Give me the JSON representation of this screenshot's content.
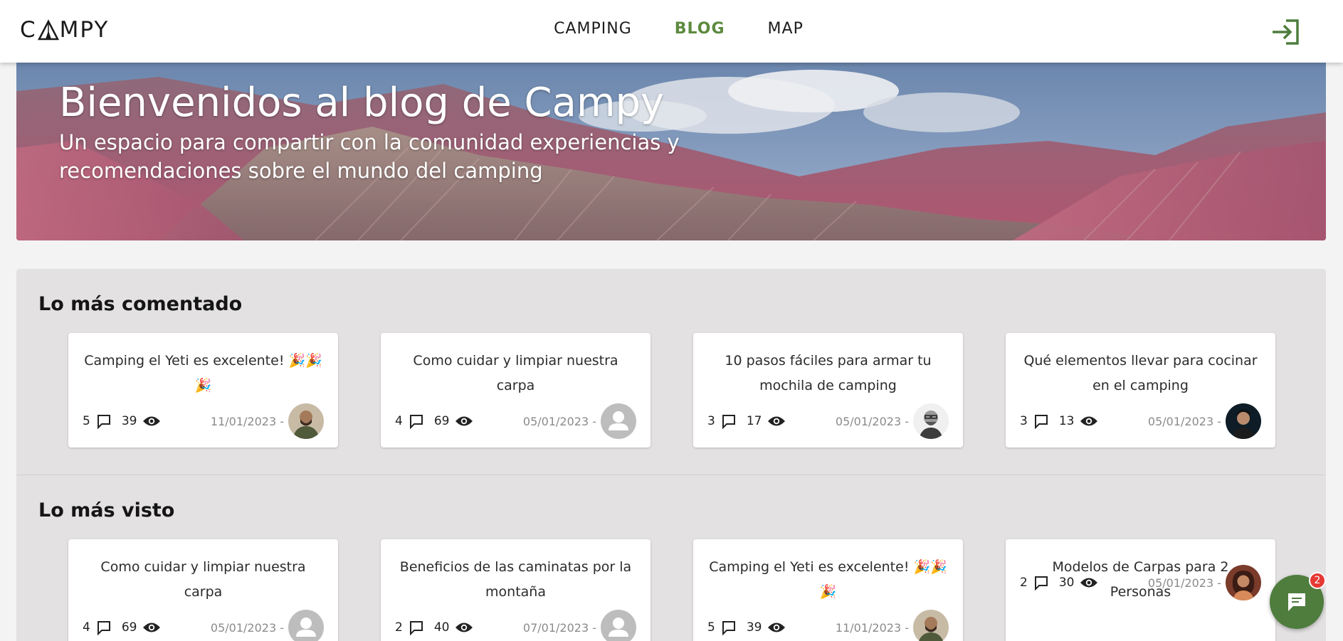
{
  "header": {
    "logo_text_left": "C",
    "logo_text_right": "MPY",
    "nav": [
      {
        "label": "CAMPING",
        "active": false
      },
      {
        "label": "BLOG",
        "active": true
      },
      {
        "label": "MAP",
        "active": false
      }
    ],
    "login_icon": "login-icon"
  },
  "hero": {
    "title": "Bienvenidos al blog de Campy",
    "subtitle": "Un espacio para compartir con la comunidad experiencias y recomendaciones sobre el mundo del camping"
  },
  "sections": [
    {
      "title": "Lo más comentado",
      "cards": [
        {
          "title": "Camping el Yeti es excelente! 🎉🎉🎉",
          "comments": "5",
          "views": "39",
          "date": "11/01/2023 -",
          "avatar": "man-beard"
        },
        {
          "title": "Como cuidar y limpiar nuestra carpa",
          "comments": "4",
          "views": "69",
          "date": "05/01/2023 -",
          "avatar": "default"
        },
        {
          "title": "10 pasos fáciles para armar tu mochila de camping",
          "comments": "3",
          "views": "17",
          "date": "05/01/2023 -",
          "avatar": "man-glasses"
        },
        {
          "title": "Qué elementos llevar para cocinar en el camping",
          "comments": "3",
          "views": "13",
          "date": "05/01/2023 -",
          "avatar": "man-dark"
        }
      ]
    },
    {
      "title": "Lo más visto",
      "cards": [
        {
          "title": "Como cuidar y limpiar nuestra carpa",
          "comments": "4",
          "views": "69",
          "date": "05/01/2023 -",
          "avatar": "default"
        },
        {
          "title": "Beneficios de las caminatas por la montaña",
          "comments": "2",
          "views": "40",
          "date": "07/01/2023 -",
          "avatar": "default"
        },
        {
          "title": "Camping el Yeti es excelente! 🎉🎉🎉",
          "comments": "5",
          "views": "39",
          "date": "11/01/2023 -",
          "avatar": "man-beard"
        },
        {
          "title": "Modelos de Carpas para 2 Personas",
          "comments": "2",
          "views": "30",
          "date": "05/01/2023 -",
          "avatar": "woman"
        }
      ]
    }
  ],
  "chat": {
    "badge": "2",
    "icon": "chat-icon"
  },
  "colors": {
    "accent": "#5c8a3e",
    "chat": "#4e7d3d",
    "badge": "#e53935"
  }
}
